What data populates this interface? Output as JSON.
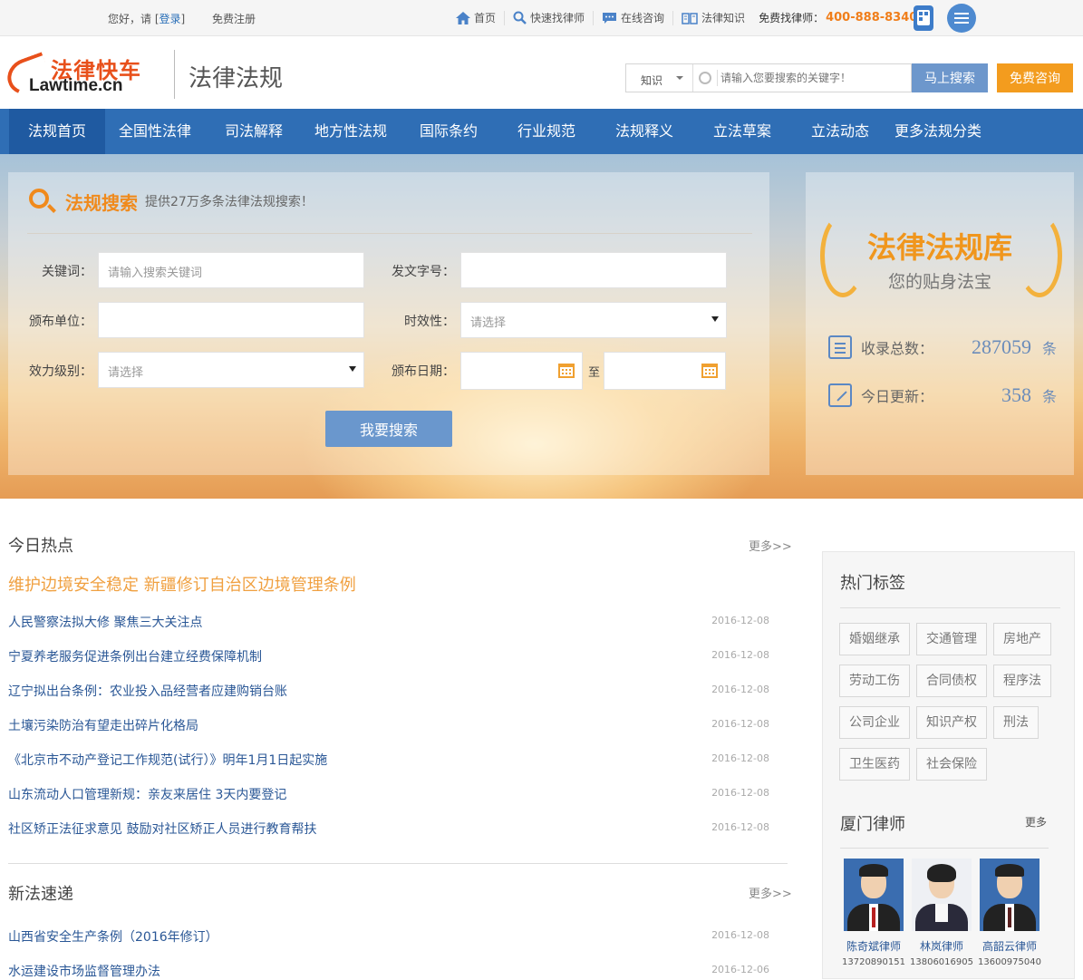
{
  "topbar": {
    "greeting": "您好，请",
    "login_open": "[",
    "login": "登录",
    "login_close": "]",
    "register": "免费注册",
    "nav": [
      {
        "label": "首页",
        "icon": "home-icon"
      },
      {
        "label": "快速找律师",
        "icon": "search-icon"
      },
      {
        "label": "在线咨询",
        "icon": "chat-icon"
      },
      {
        "label": "法律知识",
        "icon": "book-icon"
      }
    ],
    "hotline_label": "免费找律师：",
    "hotline": "400-888-8340"
  },
  "header": {
    "logo_cn": "法律快车",
    "logo_en": "Lawtime.cn",
    "section_name": "法律法规",
    "search_select": "知识",
    "search_placeholder": "请输入您要搜索的关键字！",
    "search_button": "马上搜索",
    "consult_button": "免费咨询"
  },
  "main_nav": [
    "法规首页",
    "全国性法律",
    "司法解释",
    "地方性法规",
    "国际条约",
    "行业规范",
    "法规释义",
    "立法草案",
    "立法动态",
    "更多法规分类"
  ],
  "search_panel": {
    "title": "法规搜索",
    "subtitle": "提供27万多条法律法规搜索！",
    "keyword_label": "关键词：",
    "keyword_placeholder": "请输入搜索关键词",
    "doc_no_label": "发文字号：",
    "issuer_label": "颁布单位：",
    "validity_label": "时效性：",
    "validity_value": "请选择",
    "level_label": "效力级别：",
    "level_value": "请选择",
    "date_label": "颁布日期：",
    "date_to": "至",
    "submit": "我要搜索"
  },
  "library": {
    "title": "法律法规库",
    "subtitle": "您的贴身法宝",
    "total_label": "收录总数：",
    "total": "287059",
    "today_label": "今日更新：",
    "today": "358",
    "unit": "条"
  },
  "today_hot": {
    "title": "今日热点",
    "more": "更多>>",
    "headline": "维护边境安全稳定  新疆修订自治区边境管理条例",
    "items": [
      {
        "title": "人民警察法拟大修  聚焦三大关注点",
        "date": "2016-12-08"
      },
      {
        "title": "宁夏养老服务促进条例出台建立经费保障机制",
        "date": "2016-12-08"
      },
      {
        "title": "辽宁拟出台条例：农业投入品经营者应建购销台账",
        "date": "2016-12-08"
      },
      {
        "title": "土壤污染防治有望走出碎片化格局",
        "date": "2016-12-08"
      },
      {
        "title": "《北京市不动产登记工作规范(试行）》明年1月1日起实施",
        "date": "2016-12-08"
      },
      {
        "title": "山东流动人口管理新规：亲友来居住  3天内要登记",
        "date": "2016-12-08"
      },
      {
        "title": "社区矫正法征求意见  鼓励对社区矫正人员进行教育帮扶",
        "date": "2016-12-08"
      }
    ]
  },
  "new_laws": {
    "title": "新法速递",
    "more": "更多>>",
    "items": [
      {
        "title": "山西省安全生产条例（2016年修订）",
        "date": "2016-12-08"
      },
      {
        "title": "水运建设市场监督管理办法",
        "date": "2016-12-06"
      }
    ]
  },
  "hot_tags": {
    "title": "热门标签",
    "tags": [
      "婚姻继承",
      "交通管理",
      "房地产",
      "劳动工伤",
      "合同债权",
      "程序法",
      "公司企业",
      "知识产权",
      "刑法",
      "卫生医药",
      "社会保险"
    ]
  },
  "lawyers": {
    "title": "厦门律师",
    "more": "更多",
    "items": [
      {
        "name": "陈奇斌律师",
        "phone": "13720890151"
      },
      {
        "name": "林岚律师",
        "phone": "13806016905"
      },
      {
        "name": "高韶云律师",
        "phone": "13600975040"
      }
    ]
  }
}
